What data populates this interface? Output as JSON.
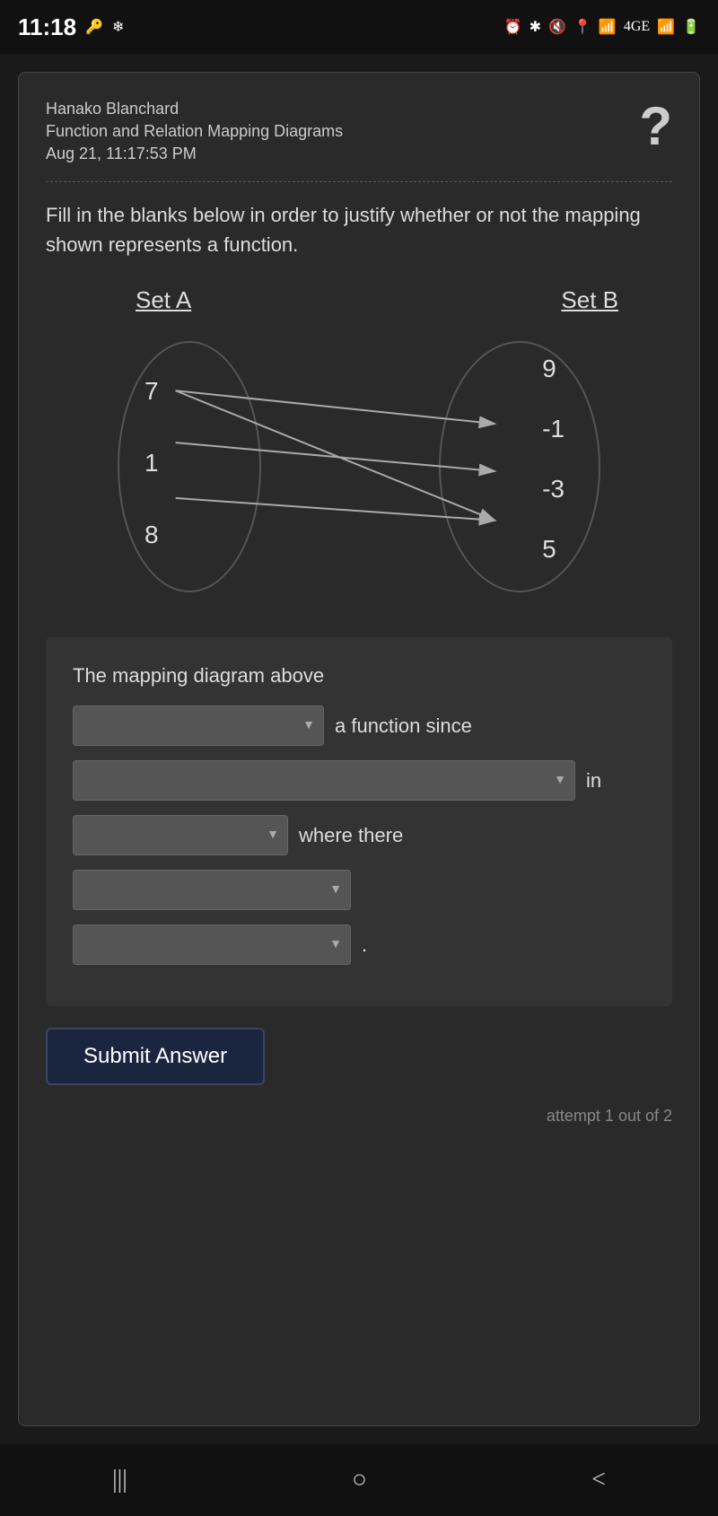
{
  "statusBar": {
    "time": "11:18",
    "leftIcons": [
      "🔑",
      "❄"
    ],
    "rightIcons": [
      "⏰",
      "✱",
      "🔇",
      "📍",
      "📶",
      "4GE",
      "📶",
      "🔋"
    ]
  },
  "header": {
    "name": "Hanako Blanchard",
    "title": "Function and Relation Mapping Diagrams",
    "date": "Aug 21, 11:17:53 PM",
    "helpIcon": "?"
  },
  "instructions": "Fill in the blanks below in order to justify whether or not the mapping shown represents a function.",
  "diagram": {
    "setALabel": "Set A",
    "setBLabel": "Set B",
    "setANumbers": [
      "7",
      "1",
      "8"
    ],
    "setBNumbers": [
      "9",
      "-1",
      "-3",
      "5"
    ]
  },
  "sentence": {
    "intro": "The mapping diagram above",
    "row1": {
      "dropdownPlaceholder": "",
      "afterText": "a function since"
    },
    "row2": {
      "dropdownPlaceholder": "",
      "afterText": "in"
    },
    "row3": {
      "dropdownPlaceholder": "",
      "afterText": "where there"
    },
    "row4": {
      "dropdownPlaceholder": ""
    },
    "row5": {
      "dropdownPlaceholder": "",
      "afterText": "."
    }
  },
  "submitButton": "Submit Answer",
  "attemptText": "attempt 1 out of 2",
  "bottomNav": {
    "back": "|||",
    "home": "○",
    "forward": "<"
  }
}
